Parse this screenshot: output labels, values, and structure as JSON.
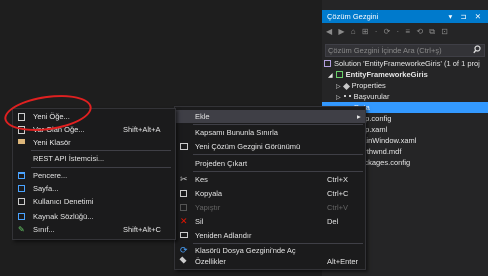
{
  "solution_explorer": {
    "title": "Çözüm Gezgini",
    "title_controls": "▾ ⊐ ✕",
    "toolbar": "◀ ▶ ⌂ ⊞ · ⟳ · ≡ ⟲ ⧉ ⊡",
    "search_placeholder": "Çözüm Gezgini İçinde Ara (Ctrl+ş)",
    "search_icon": "search-icon",
    "tree": [
      {
        "label": "Solution 'EntityFrameworkeGiris' (1 of 1 proj",
        "icon": "solution-icon",
        "indent": 2
      },
      {
        "label": "EntityFrameworkeGiris",
        "icon": "csharp-project-icon",
        "indent": 10,
        "bold": true,
        "expander": "◢"
      },
      {
        "label": "Properties",
        "icon": "wrench-icon",
        "indent": 18,
        "expander": "▷"
      },
      {
        "label": "Başvurular",
        "icon": "references-icon",
        "indent": 18,
        "expander": "▷"
      },
      {
        "label": "Data",
        "icon": "folder-icon",
        "indent": 18,
        "selected": true
      },
      {
        "label": "App.config",
        "icon": "config-file-icon",
        "indent": 18
      },
      {
        "label": "App.xaml",
        "icon": "xaml-file-icon",
        "indent": 18
      },
      {
        "label": "MainWindow.xaml",
        "icon": "xaml-file-icon",
        "indent": 18
      },
      {
        "label": "northwnd.mdf",
        "icon": "database-file-icon",
        "indent": 18
      },
      {
        "label": "packages.config",
        "icon": "config-file-icon",
        "indent": 18
      }
    ]
  },
  "context_menu": {
    "items": [
      {
        "label": "Ekle",
        "submenu_arrow": "▸",
        "highlighted": true,
        "icon": ""
      },
      {
        "label": "Kapsamı Bununla Sınırla",
        "icon": ""
      },
      {
        "label": "Yeni Çözüm Gezgini Görünümü",
        "icon": "new-view-icon"
      },
      {
        "label": "Projeden Çıkart",
        "icon": ""
      },
      {
        "label": "Kes",
        "shortcut": "Ctrl+X",
        "icon": "cut-icon"
      },
      {
        "label": "Kopyala",
        "shortcut": "Ctrl+C",
        "icon": "copy-icon"
      },
      {
        "label": "Yapıştır",
        "shortcut": "Ctrl+V",
        "icon": "paste-icon",
        "disabled": true
      },
      {
        "label": "Sil",
        "shortcut": "Del",
        "icon": "delete-icon"
      },
      {
        "label": "Yeniden Adlandır",
        "icon": "rename-icon"
      },
      {
        "label": "Klasörü Dosya Gezgini'nde Aç",
        "icon": "open-folder-icon"
      },
      {
        "label": "Özellikler",
        "shortcut": "Alt+Enter",
        "icon": "properties-icon"
      }
    ]
  },
  "submenu": {
    "items": [
      {
        "label": "Yeni Öğe...",
        "icon": "new-item-icon"
      },
      {
        "label": "Var Olan Öğe...",
        "shortcut": "Shift+Alt+A",
        "icon": "existing-item-icon"
      },
      {
        "label": "Yeni Klasör",
        "icon": "new-folder-icon"
      },
      {
        "label": "REST API İstemcisi...",
        "icon": ""
      },
      {
        "label": "Pencere...",
        "icon": "window-icon"
      },
      {
        "label": "Sayfa...",
        "icon": "page-icon"
      },
      {
        "label": "Kullanıcı Denetimi",
        "icon": "user-control-icon"
      },
      {
        "label": "Kaynak Sözlüğü...",
        "icon": "resource-dictionary-icon"
      },
      {
        "label": "Sınıf...",
        "shortcut": "Shift+Alt+C",
        "icon": "class-icon"
      }
    ]
  },
  "colors": {
    "accent": "#007acc",
    "selection": "#3399ff",
    "annotation": "#e02020"
  }
}
